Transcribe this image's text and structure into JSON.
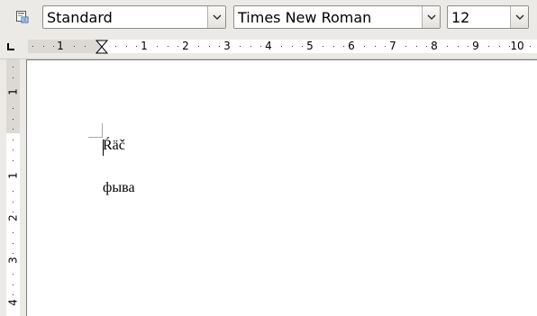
{
  "toolbar": {
    "styles_icon": "styles-and-formatting-icon",
    "paragraph_style": "Standard",
    "font_name": "Times New Roman",
    "font_size": "12",
    "dropdown_icon": "chevron-down-icon"
  },
  "ruler": {
    "tab_type_icon": "left-tab-icon",
    "horizontal_numbers": [
      "1",
      "1",
      "2",
      "3",
      "4",
      "5",
      "6",
      "7",
      "8",
      "9",
      "10"
    ],
    "vertical_numbers": [
      "1",
      "1",
      "2",
      "3",
      "4"
    ]
  },
  "document": {
    "paragraphs": [
      "Ŕäč",
      "фыва"
    ]
  }
}
